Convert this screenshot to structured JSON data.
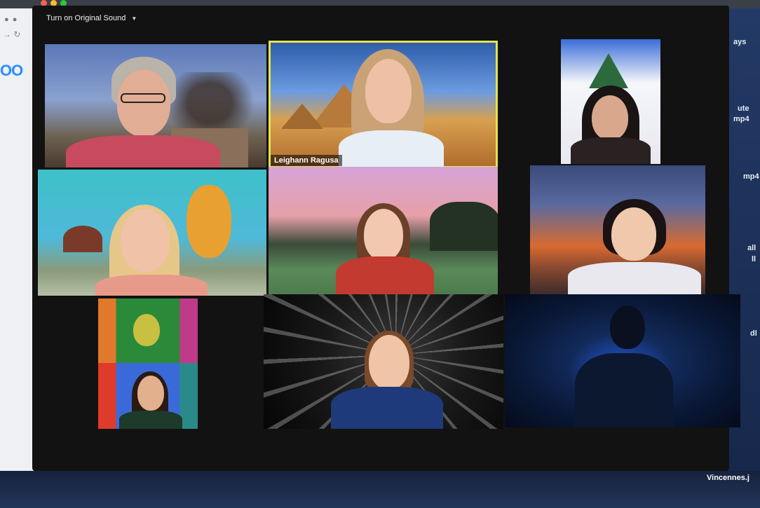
{
  "toolbar": {
    "original_sound_label": "Turn on Original Sound"
  },
  "participants": [
    {
      "name_label": ""
    },
    {
      "name_label": "Leighann Ragusa"
    }
  ],
  "desktop": {
    "right_labels": [
      "ays",
      "ute",
      "mp4",
      "mp4",
      "all",
      "ll",
      "dl",
      "Vincennes.j"
    ]
  },
  "colors": {
    "active_speaker_border": "#e4e44a",
    "window_bg": "#121212"
  }
}
